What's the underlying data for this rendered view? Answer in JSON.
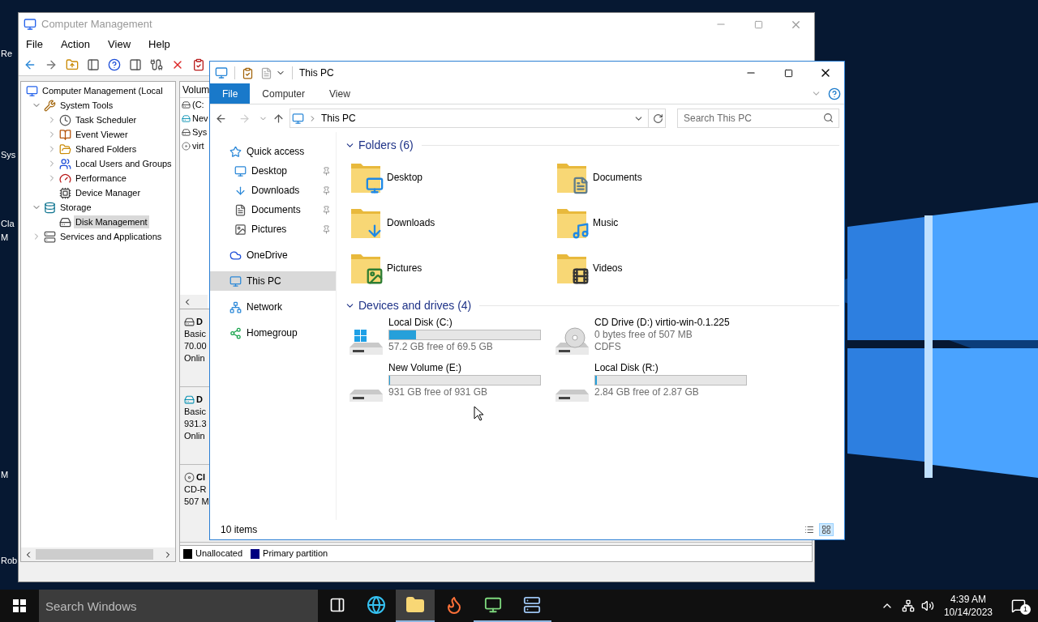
{
  "desktop": {
    "icons": [
      {
        "label": "Re"
      },
      {
        "label": "Sys"
      },
      {
        "label": "Cla"
      },
      {
        "label": "M"
      },
      {
        "label": "M"
      },
      {
        "label": "Rob"
      }
    ]
  },
  "computer_management": {
    "title": "Computer Management",
    "menu": [
      "File",
      "Action",
      "View",
      "Help"
    ],
    "tree": [
      {
        "label": "Computer Management (Local",
        "kind": "computer",
        "selected": false,
        "children": [
          {
            "label": "System Tools",
            "kind": "tools",
            "expanded": true,
            "selected": false,
            "children": [
              {
                "label": "Task Scheduler",
                "kind": "clock",
                "expanded": false,
                "selected": false
              },
              {
                "label": "Event Viewer",
                "kind": "log",
                "expanded": false,
                "selected": false
              },
              {
                "label": "Shared Folders",
                "kind": "folder",
                "expanded": false,
                "selected": false
              },
              {
                "label": "Local Users and Groups",
                "kind": "users",
                "expanded": false,
                "selected": false
              },
              {
                "label": "Performance",
                "kind": "gauge",
                "expanded": false,
                "selected": false
              },
              {
                "label": "Device Manager",
                "kind": "device",
                "selected": false
              }
            ]
          },
          {
            "label": "Storage",
            "kind": "storage",
            "expanded": true,
            "selected": false,
            "children": [
              {
                "label": "Disk Management",
                "kind": "disk",
                "selected": true
              }
            ]
          },
          {
            "label": "Services and Applications",
            "kind": "services",
            "expanded": false,
            "selected": false
          }
        ]
      }
    ],
    "volume_list": {
      "column": "Volum",
      "rows": [
        {
          "label": "(C:",
          "kind": "disk"
        },
        {
          "label": "Nev",
          "kind": "volume"
        },
        {
          "label": "Sys",
          "kind": "disk"
        },
        {
          "label": "virt",
          "kind": "cd"
        }
      ]
    },
    "disks": [
      {
        "name": "D",
        "kind": "disk",
        "lines": [
          "Basic",
          "70.00",
          "Onlin"
        ]
      },
      {
        "name": "D",
        "kind": "volume",
        "lines": [
          "Basic",
          "931.3",
          "Onlin"
        ]
      },
      {
        "name": "Cl",
        "kind": "cd",
        "lines": [
          "CD-R",
          "507 M"
        ]
      }
    ],
    "legend": [
      {
        "label": "Unallocated",
        "color": "#000000"
      },
      {
        "label": "Primary partition",
        "color": "#000080"
      }
    ]
  },
  "explorer": {
    "title": "This PC",
    "ribbon_tabs": [
      {
        "label": "File",
        "selected": true
      },
      {
        "label": "Computer",
        "selected": false
      },
      {
        "label": "View",
        "selected": false
      }
    ],
    "address": "This PC",
    "search": {
      "placeholder": "Search This PC"
    },
    "nav": [
      {
        "label": "Quick access",
        "kind": "star",
        "selected": false,
        "children": [
          {
            "label": "Desktop",
            "kind": "desktop",
            "pinned": true,
            "selected": false
          },
          {
            "label": "Downloads",
            "kind": "downloads",
            "pinned": true,
            "selected": false
          },
          {
            "label": "Documents",
            "kind": "documents",
            "pinned": true,
            "selected": false
          },
          {
            "label": "Pictures",
            "kind": "pictures",
            "pinned": true,
            "selected": false
          }
        ]
      },
      {
        "label": "OneDrive",
        "kind": "cloud",
        "selected": false
      },
      {
        "label": "This PC",
        "kind": "pc",
        "selected": true
      },
      {
        "label": "Network",
        "kind": "network",
        "selected": false
      },
      {
        "label": "Homegroup",
        "kind": "homegroup",
        "selected": false
      }
    ],
    "folders": {
      "title": "Folders (6)",
      "expanded": true,
      "items": [
        {
          "label": "Desktop",
          "kind": "desktop"
        },
        {
          "label": "Documents",
          "kind": "documents"
        },
        {
          "label": "Downloads",
          "kind": "downloads"
        },
        {
          "label": "Music",
          "kind": "music"
        },
        {
          "label": "Pictures",
          "kind": "pictures"
        },
        {
          "label": "Videos",
          "kind": "videos"
        }
      ]
    },
    "drives": {
      "title": "Devices and drives (4)",
      "expanded": true,
      "items": [
        {
          "label": "Local Disk (C:)",
          "kind": "system",
          "level": 0.18,
          "detail": "57.2 GB free of 69.5 GB"
        },
        {
          "label": "CD Drive (D:) virtio-win-0.1.225",
          "kind": "cd",
          "detail": "0 bytes free of 507 MB",
          "filesystem": "CDFS"
        },
        {
          "label": "New Volume (E:)",
          "kind": "disk",
          "level": 0,
          "detail": "931 GB free of 931 GB"
        },
        {
          "label": "Local Disk (R:)",
          "kind": "disk",
          "level": 0.01,
          "detail": "2.84 GB free of 2.87 GB"
        }
      ]
    },
    "status": "10 items",
    "views": [
      {
        "kind": "details",
        "selected": false
      },
      {
        "kind": "large-icons",
        "selected": true
      }
    ]
  },
  "taskbar": {
    "search": {
      "placeholder": "Search Windows"
    },
    "apps": [
      {
        "kind": "task-view",
        "selected": false,
        "running": false
      },
      {
        "kind": "edge",
        "selected": false,
        "running": false
      },
      {
        "kind": "explorer",
        "selected": true,
        "running": true
      },
      {
        "kind": "firefox",
        "selected": false,
        "running": false
      },
      {
        "kind": "monitor",
        "selected": false,
        "running": true
      },
      {
        "kind": "network",
        "selected": false,
        "running": true
      }
    ],
    "time": "4:39 AM",
    "date": "10/14/2023",
    "notifications": "1"
  }
}
